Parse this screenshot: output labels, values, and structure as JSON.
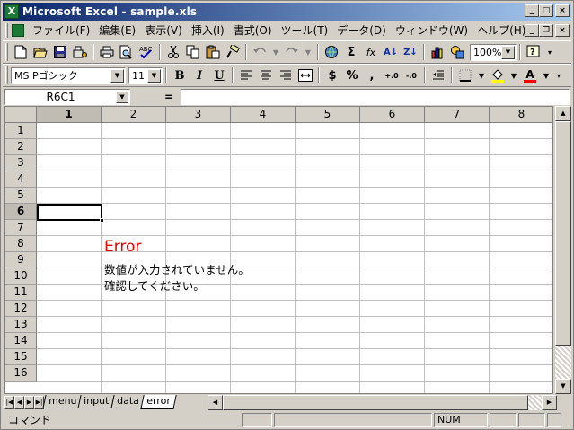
{
  "window": {
    "title": "Microsoft Excel - sample.xls",
    "app_icon_glyph": "X",
    "caption": {
      "minimize": "_",
      "maximize": "□",
      "close": "×"
    }
  },
  "menu": {
    "items": [
      "ファイル(F)",
      "編集(E)",
      "表示(V)",
      "挿入(I)",
      "書式(O)",
      "ツール(T)",
      "データ(D)",
      "ウィンドウ(W)",
      "ヘルプ(H)"
    ],
    "doc_caption": {
      "minimize": "_",
      "restore": "❐",
      "close": "×"
    }
  },
  "toolbar_standard": {
    "icons": [
      "new-icon",
      "open-icon",
      "save-icon",
      "permission-icon",
      "print-icon",
      "print-preview-icon",
      "spelling-icon",
      "cut-icon",
      "copy-icon",
      "paste-icon",
      "format-painter-icon",
      "undo-icon",
      "redo-icon",
      "hyperlink-icon",
      "autosum-icon",
      "function-icon",
      "sort-ascending-icon",
      "sort-descending-icon",
      "chart-wizard-icon",
      "drawing-icon",
      "help-icon"
    ],
    "glyphs": {
      "autosum": "Σ",
      "function": "fx",
      "sort_asc": "A↓",
      "sort_desc": "Z↓",
      "help": "?"
    },
    "zoom": "100%"
  },
  "toolbar_format": {
    "font_name": "MS Pゴシック",
    "font_size": "11",
    "bold": "B",
    "italic": "I",
    "underline": "U",
    "currency": "$",
    "percent": "%",
    "comma": ",",
    "inc_decimal": "+.0",
    "dec_decimal": "-.0",
    "font_color_glyph": "A",
    "colors": {
      "fill": "#ffff00",
      "font": "#ff0000"
    }
  },
  "formula_bar": {
    "name_box": "R6C1",
    "equals": "=",
    "formula": ""
  },
  "grid": {
    "columns": [
      "1",
      "2",
      "3",
      "4",
      "5",
      "6",
      "7",
      "8"
    ],
    "active_column": "1",
    "rows": [
      "1",
      "2",
      "3",
      "4",
      "5",
      "6",
      "7",
      "8",
      "9",
      "10",
      "11",
      "12",
      "13",
      "14",
      "15",
      "16"
    ],
    "active_row": "6"
  },
  "content": {
    "error_title": "Error",
    "error_line1": "数値が入力されていません。",
    "error_line2": "確認してください。",
    "error_color": "#e00000"
  },
  "sheets": {
    "tabs": [
      "menu",
      "input",
      "data",
      "error"
    ],
    "active": "error",
    "nav": [
      "|◀",
      "◀",
      "▶",
      "▶|"
    ]
  },
  "status": {
    "mode": "コマンド",
    "num": "NUM"
  }
}
